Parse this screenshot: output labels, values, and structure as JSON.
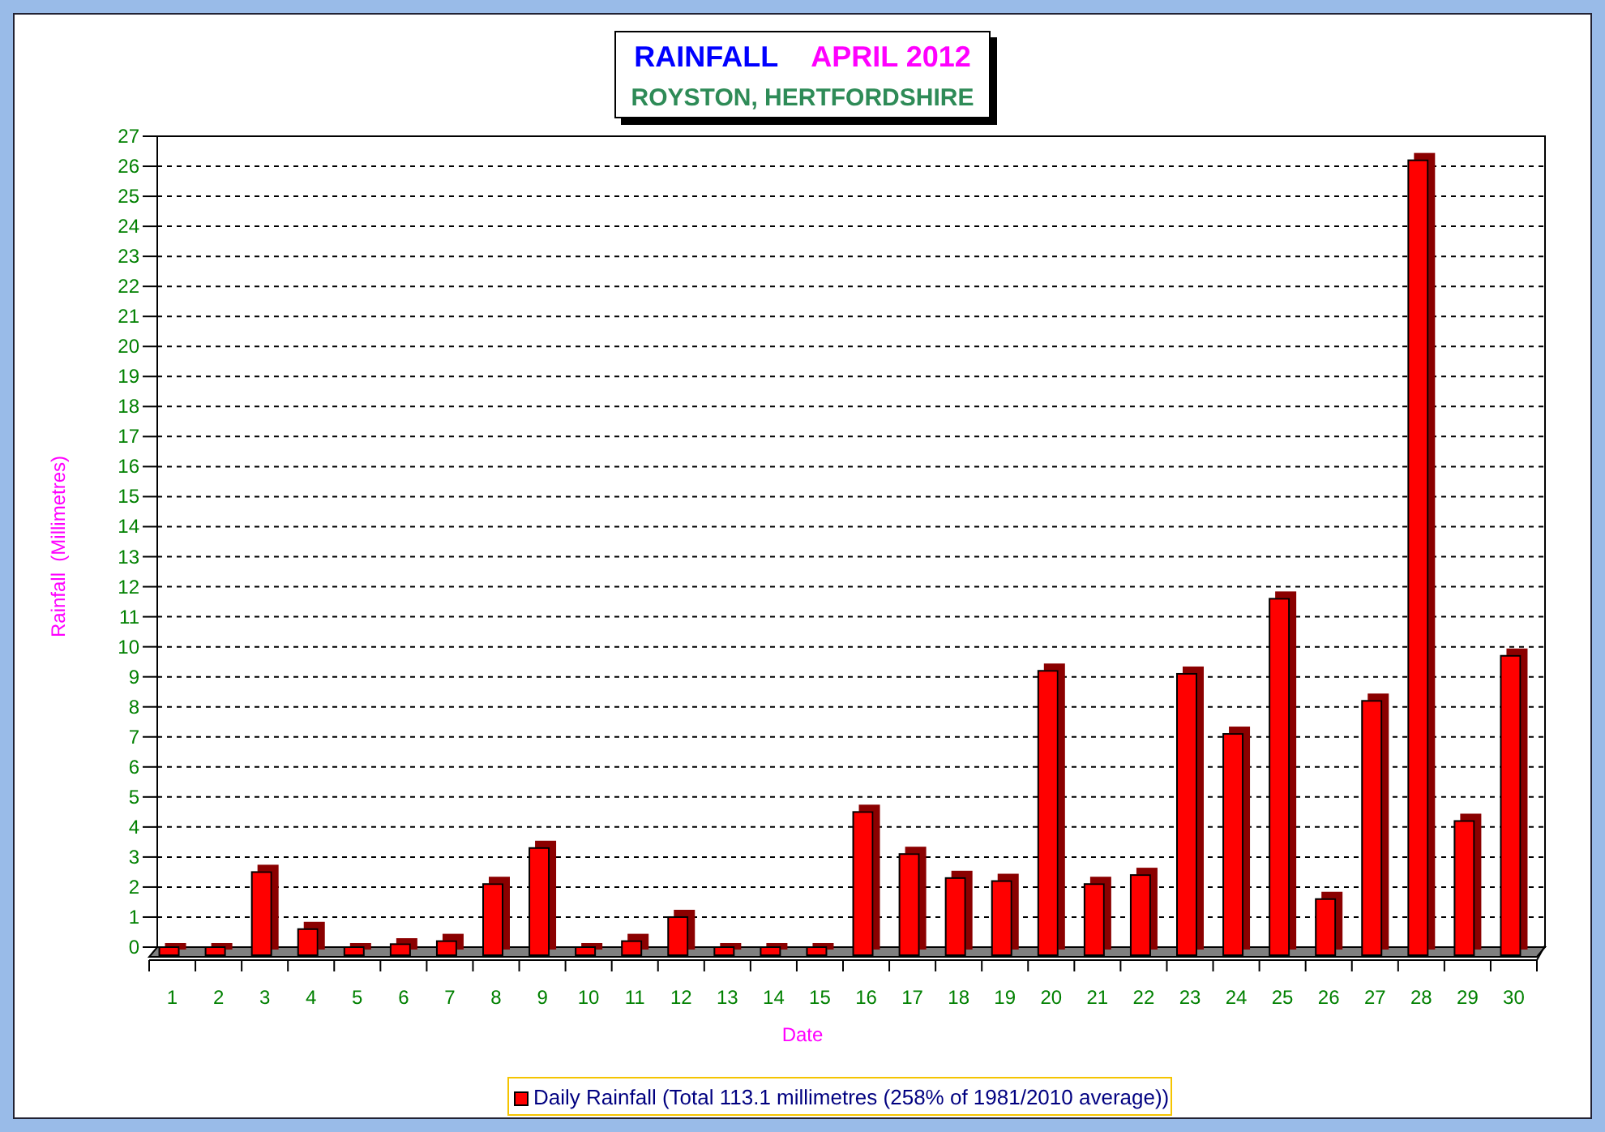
{
  "title": {
    "main": "RAINFALL",
    "period": "APRIL 2012",
    "location": "ROYSTON, HERTFORDSHIRE"
  },
  "chart_data": {
    "type": "bar",
    "xlabel": "Date",
    "ylabel": "Rainfall  (Millimetres)",
    "categories": [
      "1",
      "2",
      "3",
      "4",
      "5",
      "6",
      "7",
      "8",
      "9",
      "10",
      "11",
      "12",
      "13",
      "14",
      "15",
      "16",
      "17",
      "18",
      "19",
      "20",
      "21",
      "22",
      "23",
      "24",
      "25",
      "26",
      "27",
      "28",
      "29",
      "30"
    ],
    "series": [
      {
        "name": "Daily Rainfall (Total 113.1 millimetres (258% of 1981/2010 average))",
        "color": "#ff0000",
        "values": [
          0,
          0,
          2.5,
          0.6,
          0,
          0.1,
          0.2,
          2.1,
          3.3,
          0,
          0.2,
          1.0,
          0,
          0,
          0,
          4.5,
          3.1,
          2.3,
          2.2,
          9.2,
          2.1,
          2.4,
          9.1,
          7.1,
          11.6,
          1.6,
          8.2,
          26.2,
          4.2,
          9.7
        ]
      }
    ],
    "ylim": [
      0,
      27
    ],
    "grid": true,
    "yticks": [
      0,
      1,
      2,
      3,
      4,
      5,
      6,
      7,
      8,
      9,
      10,
      11,
      12,
      13,
      14,
      15,
      16,
      17,
      18,
      19,
      20,
      21,
      22,
      23,
      24,
      25,
      26,
      27
    ]
  }
}
